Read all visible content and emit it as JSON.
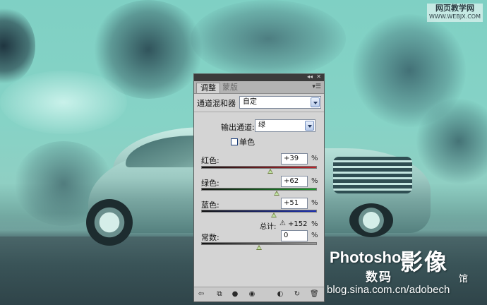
{
  "watermark": {
    "site_name": "网页教学网",
    "site_url": "WWW.WEBJX.COM",
    "brand": "Photoshop",
    "big_text": "影像",
    "sub_text": "数码",
    "pavilion": "馆",
    "blog_url": "blog.sina.com.cn/adobech"
  },
  "panel": {
    "tabs": [
      {
        "label": "调整",
        "active": true
      },
      {
        "label": "蒙版",
        "active": false
      }
    ],
    "adjustment_name": "通道混和器",
    "preset_value": "自定",
    "output_channel_label": "输出通道:",
    "output_channel_value": "绿",
    "monochrome_label": "单色",
    "monochrome_checked": false,
    "red": {
      "label": "红色:",
      "value": "+39",
      "unit": "%",
      "slider_percent": 39
    },
    "green": {
      "label": "绿色:",
      "value": "+62",
      "unit": "%",
      "slider_percent": 62
    },
    "blue": {
      "label": "蓝色:",
      "value": "+51",
      "unit": "%",
      "slider_percent": 51
    },
    "total": {
      "label": "总计:",
      "value": "+152",
      "unit": "%"
    },
    "constant": {
      "label": "常数:",
      "value": "0",
      "unit": "%",
      "slider_percent": 0
    },
    "toolbar_icons": [
      "back-arrow-icon",
      "clip-layer-icon",
      "visibility-icon",
      "eye-icon",
      "previous-state-icon",
      "reset-icon",
      "delete-icon"
    ]
  },
  "colors": {
    "red_track": "#c0242a",
    "green_track": "#1f9a2e",
    "blue_track": "#1a2fb4",
    "gray_track": "#4a4a4a"
  }
}
